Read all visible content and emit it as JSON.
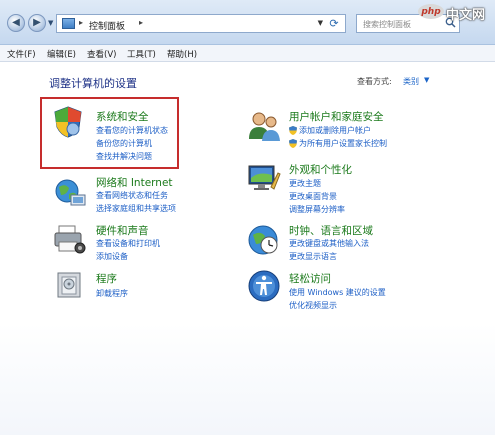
{
  "address_bar": {
    "crumb": "控制面板",
    "search_placeholder": "搜索控制面板"
  },
  "menubar": {
    "items": [
      "文件(F)",
      "编辑(E)",
      "查看(V)",
      "工具(T)",
      "帮助(H)"
    ]
  },
  "header": {
    "title": "调整计算机的设置",
    "view_by_label": "查看方式:",
    "view_by_value": "类别"
  },
  "categories": {
    "system_security": {
      "title": "系统和安全",
      "links": [
        "查看您的计算机状态",
        "备份您的计算机",
        "查找并解决问题"
      ]
    },
    "network": {
      "title": "网络和 Internet",
      "links": [
        "查看网络状态和任务",
        "选择家庭组和共享选项"
      ]
    },
    "hardware": {
      "title": "硬件和声音",
      "links": [
        "查看设备和打印机",
        "添加设备"
      ]
    },
    "programs": {
      "title": "程序",
      "links": [
        "卸载程序"
      ]
    },
    "user_accounts": {
      "title": "用户帐户和家庭安全",
      "links": [
        "添加或删除用户帐户",
        "为所有用户设置家长控制"
      ]
    },
    "appearance": {
      "title": "外观和个性化",
      "links": [
        "更改主题",
        "更改桌面背景",
        "调整屏幕分辨率"
      ]
    },
    "clock": {
      "title": "时钟、语言和区域",
      "links": [
        "更改键盘或其他输入法",
        "更改显示语言"
      ]
    },
    "ease": {
      "title": "轻松访问",
      "links": [
        "使用 Windows 建议的设置",
        "优化视频显示"
      ]
    }
  },
  "watermark": {
    "logo": "php",
    "text": "中文网"
  },
  "colors": {
    "category_title": "#1b7a1b",
    "link": "#1d5fc6",
    "page_title": "#1e3287",
    "highlight_box": "#c62d2d"
  }
}
